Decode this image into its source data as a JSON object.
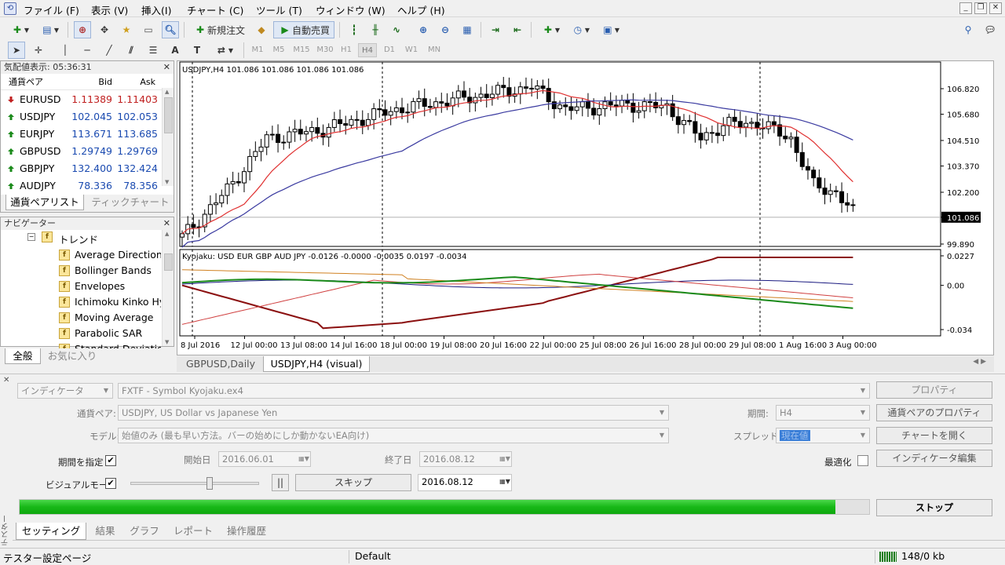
{
  "menu": {
    "items": [
      "ファイル (F)",
      "表示 (V)",
      "挿入(I)",
      "チャート (C)",
      "ツール (T)",
      "ウィンドウ (W)",
      "ヘルプ (H)"
    ]
  },
  "toolbar": {
    "new_order_label": "新規注文",
    "auto_trade_label": "自動売買",
    "timeframes": [
      "M1",
      "M5",
      "M15",
      "M30",
      "H1",
      "H4",
      "D1",
      "W1",
      "MN"
    ],
    "active_timeframe": "H4"
  },
  "market_watch": {
    "title": "気配値表示: 05:36:31",
    "headers": {
      "symbol": "通貨ペア",
      "bid": "Bid",
      "ask": "Ask"
    },
    "rows": [
      {
        "symbol": "EURUSD",
        "bid": "1.11389",
        "ask": "1.11403",
        "direction": "down"
      },
      {
        "symbol": "USDJPY",
        "bid": "102.045",
        "ask": "102.053",
        "direction": "up"
      },
      {
        "symbol": "EURJPY",
        "bid": "113.671",
        "ask": "113.685",
        "direction": "up"
      },
      {
        "symbol": "GBPUSD",
        "bid": "1.29749",
        "ask": "1.29769",
        "direction": "up"
      },
      {
        "symbol": "GBPJPY",
        "bid": "132.400",
        "ask": "132.424",
        "direction": "up"
      },
      {
        "symbol": "AUDJPY",
        "bid": "78.336",
        "ask": "78.356",
        "direction": "up"
      }
    ],
    "tabs": [
      "通貨ペアリスト",
      "ティックチャート"
    ]
  },
  "navigator": {
    "title": "ナビゲーター",
    "folder": "トレンド",
    "items": [
      "Average Directional",
      "Bollinger Bands",
      "Envelopes",
      "Ichimoku Kinko Hy",
      "Moving Average",
      "Parabolic SAR",
      "Standard Deviation"
    ],
    "tabs": [
      "全般",
      "お気に入り"
    ]
  },
  "chart": {
    "main_label": "USDJPY,H4  101.086 101.086 101.086 101.086",
    "sub_label": "Kyojaku: USD EUR GBP AUD JPY -0.0126 -0.0000 -0.0035 0.0197 -0.0034",
    "price_ticks": [
      "106.820",
      "105.680",
      "104.510",
      "103.370",
      "102.200",
      "101.086",
      "99.890"
    ],
    "current_price": "101.086",
    "sub_ticks": [
      "0.0227",
      "0.00",
      "-0.034"
    ],
    "date_ticks": [
      "8 Jul 2016",
      "12 Jul 00:00",
      "13 Jul 08:00",
      "14 Jul 16:00",
      "18 Jul 00:00",
      "19 Jul 08:00",
      "20 Jul 16:00",
      "22 Jul 00:00",
      "25 Jul 08:00",
      "26 Jul 16:00",
      "28 Jul 00:00",
      "29 Jul 08:00",
      "1 Aug 16:00",
      "3 Aug 00:00"
    ],
    "tabs": [
      "GBPUSD,Daily",
      "USDJPY,H4 (visual)"
    ],
    "colors": {
      "bull": "#ffffff",
      "bear": "#000000",
      "ma_fast": "#e03030",
      "ma_slow": "#3a3aa0",
      "usd": "#8b1010",
      "eur": "#1a1a80",
      "gbp": "#d04040",
      "aud": "#d08020",
      "jpy": "#1a8a1a"
    }
  },
  "tester": {
    "type_value": "インディケータ",
    "expert_value": "FXTF - Symbol Kyojaku.ex4",
    "symbol_label": "通貨ペア:",
    "symbol_value": "USDJPY, US Dollar vs Japanese Yen",
    "model_label": "モデル:",
    "model_value": "始値のみ (最も早い方法。バーの始めにしか動かないEA向け)",
    "period_label": "期間:",
    "period_value": "H4",
    "spread_label": "スプレッド:",
    "spread_value": "現在値",
    "use_date_label": "期間を指定",
    "start_label": "開始日",
    "start_value": "2016.06.01",
    "end_label": "終了日",
    "end_value": "2016.08.12",
    "optimize_label": "最適化",
    "visual_label": "ビジュアルモード",
    "skip_label": "スキップ",
    "skip_date": "2016.08.12",
    "buttons": {
      "properties": "プロパティ",
      "symbol_properties": "通貨ペアのプロパティ",
      "open_chart": "チャートを開く",
      "edit_indicator": "インディケータ編集",
      "stop": "ストップ"
    },
    "progress": 0.96,
    "pause_label": "||",
    "side_label": "テスター",
    "tabs": [
      "セッティング",
      "結果",
      "グラフ",
      "レポート",
      "操作履歴"
    ]
  },
  "status": {
    "left": "テスター設定ページ",
    "profile": "Default",
    "traffic": "148/0 kb"
  }
}
